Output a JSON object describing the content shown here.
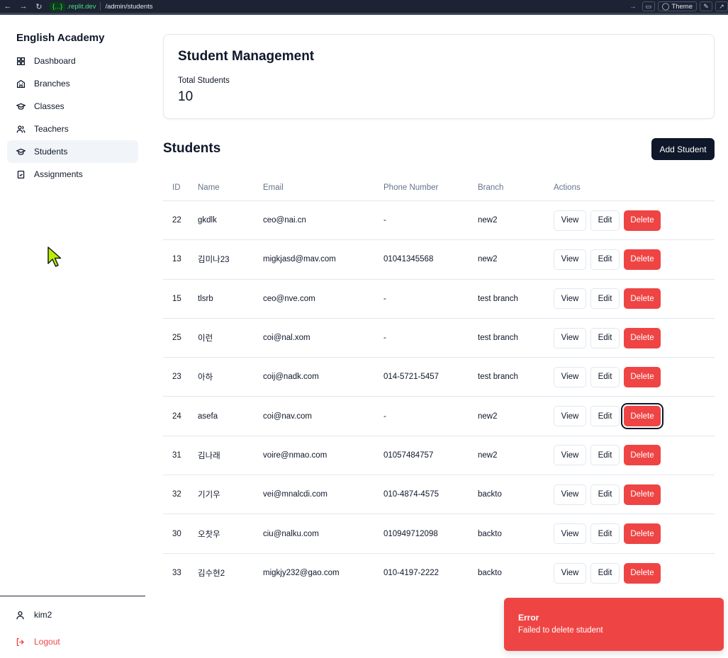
{
  "browser": {
    "url_chip": "{...}",
    "url_domain": ".replit.dev",
    "url_path": "/admin/students",
    "theme_label": "Theme"
  },
  "sidebar": {
    "brand": "English Academy",
    "items": [
      {
        "label": "Dashboard",
        "icon": "grid-icon",
        "active": false
      },
      {
        "label": "Branches",
        "icon": "building-icon",
        "active": false
      },
      {
        "label": "Classes",
        "icon": "graduation-cap-icon",
        "active": false
      },
      {
        "label": "Teachers",
        "icon": "users-icon",
        "active": false
      },
      {
        "label": "Students",
        "icon": "graduation-cap-icon",
        "active": true
      },
      {
        "label": "Assignments",
        "icon": "clipboard-check-icon",
        "active": false
      }
    ],
    "user_name": "kim2",
    "logout_label": "Logout"
  },
  "summary": {
    "title": "Student Management",
    "total_label": "Total Students",
    "total_value": "10"
  },
  "students_section": {
    "title": "Students",
    "add_button": "Add Student"
  },
  "table": {
    "headers": {
      "id": "ID",
      "name": "Name",
      "email": "Email",
      "phone": "Phone Number",
      "branch": "Branch",
      "actions": "Actions"
    },
    "rows": [
      {
        "id": "22",
        "name": "gkdlk",
        "email": "ceo@nai.cn",
        "phone": "-",
        "branch": "new2"
      },
      {
        "id": "13",
        "name": "김미나23",
        "email": "migkjasd@mav.com",
        "phone": "01041345568",
        "branch": "new2"
      },
      {
        "id": "15",
        "name": "tlsrb",
        "email": "ceo@nve.com",
        "phone": "-",
        "branch": "test branch"
      },
      {
        "id": "25",
        "name": "이런",
        "email": "coi@nal.xom",
        "phone": "-",
        "branch": "test branch"
      },
      {
        "id": "23",
        "name": "아하",
        "email": "coij@nadk.com",
        "phone": "014-5721-5457",
        "branch": "test branch"
      },
      {
        "id": "24",
        "name": "asefa",
        "email": "coi@nav.com",
        "phone": "-",
        "branch": "new2"
      },
      {
        "id": "31",
        "name": "김나래",
        "email": "voire@nmao.com",
        "phone": "01057484757",
        "branch": "new2"
      },
      {
        "id": "32",
        "name": "기기우",
        "email": "vei@mnalcdi.com",
        "phone": "010-4874-4575",
        "branch": "backto"
      },
      {
        "id": "30",
        "name": "오찻우",
        "email": "ciu@nalku.com",
        "phone": "010949712098",
        "branch": "backto"
      },
      {
        "id": "33",
        "name": "김수현2",
        "email": "migkjy232@gao.com",
        "phone": "010-4197-2222",
        "branch": "backto"
      }
    ],
    "actions": {
      "view": "View",
      "edit": "Edit",
      "delete": "Delete"
    }
  },
  "toast": {
    "title": "Error",
    "message": "Failed to delete student"
  },
  "colors": {
    "primary": "#0f172a",
    "danger": "#ef4444",
    "border": "#e2e8f0",
    "muted_text": "#64748b"
  }
}
